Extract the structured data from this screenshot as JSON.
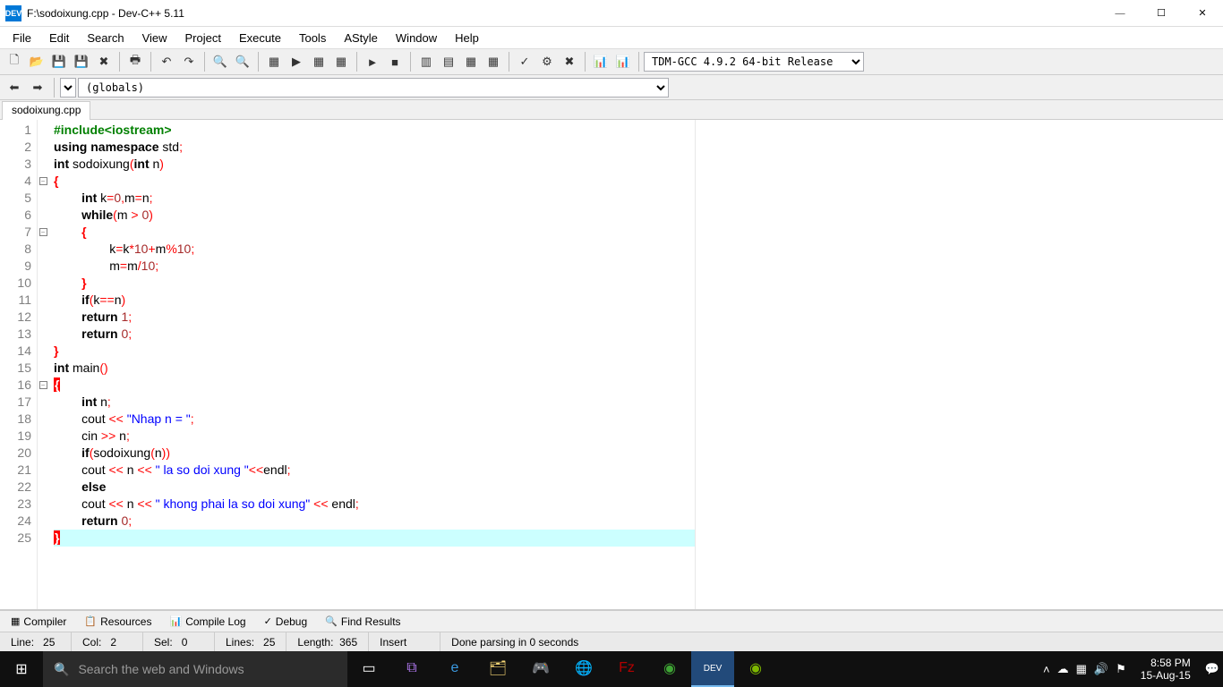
{
  "window": {
    "title": "F:\\sodoixung.cpp - Dev-C++ 5.11",
    "icon_label": "DEV"
  },
  "menu": [
    "File",
    "Edit",
    "Search",
    "View",
    "Project",
    "Execute",
    "Tools",
    "AStyle",
    "Window",
    "Help"
  ],
  "compiler_dropdown": "TDM-GCC 4.9.2 64-bit Release",
  "globals_dropdown": "(globals)",
  "tab_name": "sodoixung.cpp",
  "code_lines": [
    {
      "n": 1,
      "fold": "",
      "html": "<span class='pp'>#include&lt;iostream&gt;</span>"
    },
    {
      "n": 2,
      "fold": "",
      "html": "<span class='kw'>using</span> <span class='kw'>namespace</span> std<span class='pun'>;</span>"
    },
    {
      "n": 3,
      "fold": "",
      "html": "<span class='kw'>int</span> sodoixung<span class='pun'>(</span><span class='kw'>int</span> n<span class='pun'>)</span>"
    },
    {
      "n": 4,
      "fold": "box",
      "html": "<span class='pun-bold'>{</span>"
    },
    {
      "n": 5,
      "fold": "",
      "html": "        <span class='kw'>int</span> k<span class='pun'>=</span><span class='num'>0</span><span class='pun'>,</span>m<span class='pun'>=</span>n<span class='pun'>;</span>"
    },
    {
      "n": 6,
      "fold": "",
      "html": "        <span class='kw'>while</span><span class='pun'>(</span>m <span class='pun'>&gt;</span> <span class='num'>0</span><span class='pun'>)</span>"
    },
    {
      "n": 7,
      "fold": "box",
      "html": "        <span class='pun-bold'>{</span>"
    },
    {
      "n": 8,
      "fold": "",
      "html": "                k<span class='pun'>=</span>k<span class='pun'>*</span><span class='num'>10</span><span class='pun'>+</span>m<span class='pun'>%</span><span class='num'>10</span><span class='pun'>;</span>"
    },
    {
      "n": 9,
      "fold": "",
      "html": "                m<span class='pun'>=</span>m<span class='pun'>/</span><span class='num'>10</span><span class='pun'>;</span>"
    },
    {
      "n": 10,
      "fold": "",
      "html": "        <span class='pun-bold'>}</span>"
    },
    {
      "n": 11,
      "fold": "",
      "html": "        <span class='kw'>if</span><span class='pun'>(</span>k<span class='pun'>==</span>n<span class='pun'>)</span>"
    },
    {
      "n": 12,
      "fold": "",
      "html": "        <span class='kw'>return</span> <span class='num'>1</span><span class='pun'>;</span>"
    },
    {
      "n": 13,
      "fold": "",
      "html": "        <span class='kw'>return</span> <span class='num'>0</span><span class='pun'>;</span>"
    },
    {
      "n": 14,
      "fold": "",
      "html": "<span class='pun-bold'>}</span>"
    },
    {
      "n": 15,
      "fold": "",
      "html": "<span class='kw'>int</span> main<span class='pun'>()</span>"
    },
    {
      "n": 16,
      "fold": "box",
      "html": "<span class='hl-brace'>{</span>"
    },
    {
      "n": 17,
      "fold": "",
      "html": "        <span class='kw'>int</span> n<span class='pun'>;</span>"
    },
    {
      "n": 18,
      "fold": "",
      "html": "        cout <span class='pun'>&lt;&lt;</span> <span class='str'>\"Nhap n = \"</span><span class='pun'>;</span>"
    },
    {
      "n": 19,
      "fold": "",
      "html": "        cin <span class='pun'>&gt;&gt;</span> n<span class='pun'>;</span>"
    },
    {
      "n": 20,
      "fold": "",
      "html": "        <span class='kw'>if</span><span class='pun'>(</span>sodoixung<span class='pun'>(</span>n<span class='pun'>))</span>"
    },
    {
      "n": 21,
      "fold": "",
      "html": "        cout <span class='pun'>&lt;&lt;</span> n <span class='pun'>&lt;&lt;</span> <span class='str'>\" la so doi xung \"</span><span class='pun'>&lt;&lt;</span>endl<span class='pun'>;</span>"
    },
    {
      "n": 22,
      "fold": "",
      "html": "        <span class='kw'>else</span>"
    },
    {
      "n": 23,
      "fold": "",
      "html": "        cout <span class='pun'>&lt;&lt;</span> n <span class='pun'>&lt;&lt;</span> <span class='str'>\" khong phai la so doi xung\"</span> <span class='pun'>&lt;&lt;</span> endl<span class='pun'>;</span>"
    },
    {
      "n": 24,
      "fold": "",
      "html": "        <span class='kw'>return</span> <span class='num'>0</span><span class='pun'>;</span>"
    },
    {
      "n": 25,
      "fold": "",
      "html": "<span class='hl-brace'>}</span>",
      "current": true
    }
  ],
  "bottom_tabs": [
    "Compiler",
    "Resources",
    "Compile Log",
    "Debug",
    "Find Results"
  ],
  "status": {
    "line_lbl": "Line:",
    "line": "25",
    "col_lbl": "Col:",
    "col": "2",
    "sel_lbl": "Sel:",
    "sel": "0",
    "lines_lbl": "Lines:",
    "lines": "25",
    "len_lbl": "Length:",
    "len": "365",
    "mode": "Insert",
    "msg": "Done parsing in 0 seconds"
  },
  "taskbar": {
    "search_placeholder": "Search the web and Windows",
    "time": "8:58 PM",
    "date": "15-Aug-15"
  }
}
